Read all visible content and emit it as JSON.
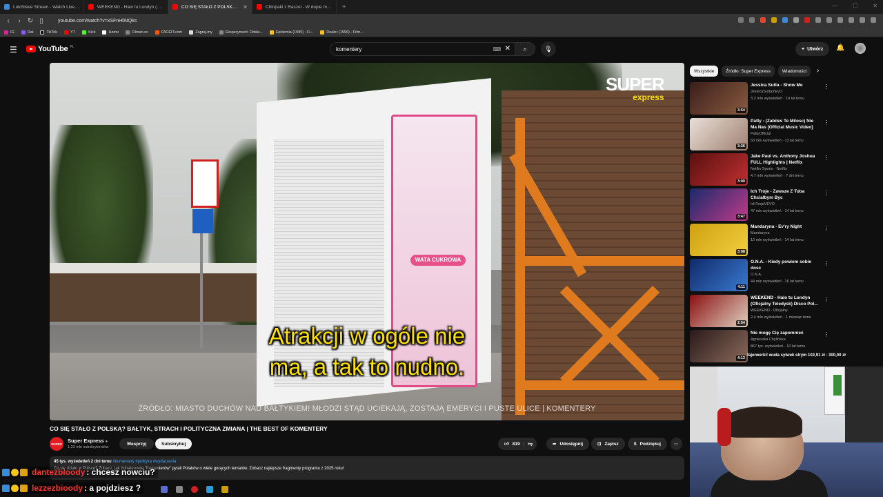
{
  "browser": {
    "tabs": [
      {
        "title": "LukiSteve Stream - Watch Live on",
        "active": false,
        "color": "#3b8bd9"
      },
      {
        "title": "WEEKEND - Halo tu Londyn (Oficjaln",
        "active": false,
        "color": "#ff0000"
      },
      {
        "title": "CO SIĘ STAŁO Z POLSKĄ? BAŁ",
        "active": true,
        "color": "#ff0000"
      },
      {
        "title": "Chłopaki z Raszei - W dupie mam.co",
        "active": false,
        "color": "#ff0000"
      }
    ],
    "url": "youtube.com/watch?v=xSFnHfAtQks",
    "bookmarks": [
      {
        "label": "IG",
        "color": "#d6249f"
      },
      {
        "label": "Rat",
        "color": "#8a5cf5"
      },
      {
        "label": "TikTok",
        "color": "#111111"
      },
      {
        "label": "YT",
        "color": "#ff0000"
      },
      {
        "label": "Kick",
        "color": "#53fc18"
      },
      {
        "label": "Home",
        "color": "#ffffff"
      },
      {
        "label": "Filman.cc",
        "color": "#888888"
      },
      {
        "label": "FACEIT.com",
        "color": "#ff5500"
      },
      {
        "label": "Zagraj.my",
        "color": "#dddddd"
      },
      {
        "label": "Eksperyment: Odsła...",
        "color": "#888888"
      },
      {
        "label": "Epidemia (1995) - Fi...",
        "color": "#f5c518"
      },
      {
        "label": "Dealer (1996) - Film...",
        "color": "#f5c518"
      }
    ]
  },
  "header": {
    "logo_text": "YouTube",
    "country_code": "PL",
    "search_value": "komentery",
    "create_label": "Utwórz"
  },
  "video": {
    "subtitle_line1": "Atrakcji w ogóle nie",
    "subtitle_line2": "ma, a tak to nudno.",
    "source_line": "ŹRÓDŁO: MIASTO DUCHÓW NAD BAŁTYKIEM! MŁODZI STĄD UCIEKAJĄ, ZOSTAJĄ EMERYCI I PUSTE ULICE | KOMENTERY",
    "brand_line1": "SUPER",
    "brand_line2": "express",
    "kiosk_text": "WATA CUKROWA",
    "title": "CO SIĘ STAŁO Z POLSKĄ? BAŁTYK, STRACH I POLITYCZNA ZMIANA | THE BEST OF KOMENTERY"
  },
  "channel": {
    "avatar_text": "SUPER",
    "name": "Super Express",
    "subscribers": "1,23 mln subskrybentów",
    "join_label": "Wesprzyj",
    "subscribe_label": "Subskrybuj"
  },
  "actions": {
    "likes": "819",
    "share_label": "Udostępnij",
    "save_label": "Zapisz",
    "thanks_label": "Podziękuj"
  },
  "description": {
    "meta": "45 tys. wyświetleń  2 dni temu",
    "tags": "#komentery #polityka #wydarzenia",
    "text": "Co się działo w Polsce? Zobacz, jak bohaterowie \"Komenterów\" pytali Polaków o wiele gorących tematów. Zobacz najlepsze fragmenty programu z 2025 roku!"
  },
  "sidebar": {
    "chips": [
      "Wszystkie",
      "Źródło: Super Express",
      "Wiadomości"
    ],
    "videos": [
      {
        "title": "Jessica Sutta - Show Me",
        "channel": "JessicaSuttaVEVO",
        "meta": "3,2 mln wyświetleń · 14 lat temu",
        "duration": "3:54",
        "colors": [
          "#3a1f1a",
          "#8a5a40"
        ]
      },
      {
        "title": "Patty - (Zabiles Te Milosc) Nie Ma Nas [Official Music Video]",
        "channel": "PattyOfficial",
        "meta": "63 mln wyświetleń · 13 lat temu",
        "duration": "3:26",
        "colors": [
          "#e8e0d8",
          "#a08070"
        ]
      },
      {
        "title": "Jake Paul vs. Anthony Joshua FULL Highlights | Netflix",
        "channel": "Netflix Sports · Netflix",
        "meta": "4,7 mln wyświetleń · 7 dni temu",
        "duration": "3:00",
        "colors": [
          "#5a1010",
          "#c03030"
        ]
      },
      {
        "title": "Ich Troje - Zawsze Z Toba Chcialbym Byc",
        "channel": "IchTrojeVEVO",
        "meta": "47 mln wyświetleń · 14 lat temu",
        "duration": "3:47",
        "colors": [
          "#1a2a6a",
          "#c03a8a"
        ]
      },
      {
        "title": "Mandaryna - Ev'ry Night",
        "channel": "Mandaryna",
        "meta": "12 mln wyświetleń · 14 lat temu",
        "duration": "3:08",
        "colors": [
          "#d0a010",
          "#f0d040"
        ]
      },
      {
        "title": "O.N.A. - Kiedy powiem sobie dosc",
        "channel": "O.N.A.",
        "meta": "44 mln wyświetleń · 16 lat temu",
        "duration": "4:11",
        "colors": [
          "#102a6a",
          "#3a7ad0"
        ]
      },
      {
        "title": "WEEKEND - Halo tu Londyn (Oficjalny Teledysk) Disco Pol...",
        "channel": "WEEKEND - Oficjalny",
        "meta": "2,4 mln wyświetleń · 1 miesiąc temu",
        "duration": "2:54",
        "colors": [
          "#8a1010",
          "#e0d0c0"
        ]
      },
      {
        "title": "Nie mogę Cię zapomnieć",
        "channel": "Agnieszka Chylińska",
        "meta": "867 tys. wyświetleń · 10 lat temu",
        "duration": "4:13",
        "colors": [
          "#2a1a1a",
          "#8a6a5a"
        ]
      }
    ]
  },
  "donation_text": "fajerwerki! wuda sylwek strym  102,91 zł  ·  300,00 zł",
  "chat": [
    {
      "user": "dantezbioody",
      "message": ": chcesz nowciu?"
    },
    {
      "user": "lezzezbioody",
      "message": ": a pojdziesz ?"
    }
  ],
  "colors": {
    "accent": "#ff0000",
    "background": "#0f0f0f",
    "surface": "#272727",
    "subtitle": "#ffe000"
  }
}
